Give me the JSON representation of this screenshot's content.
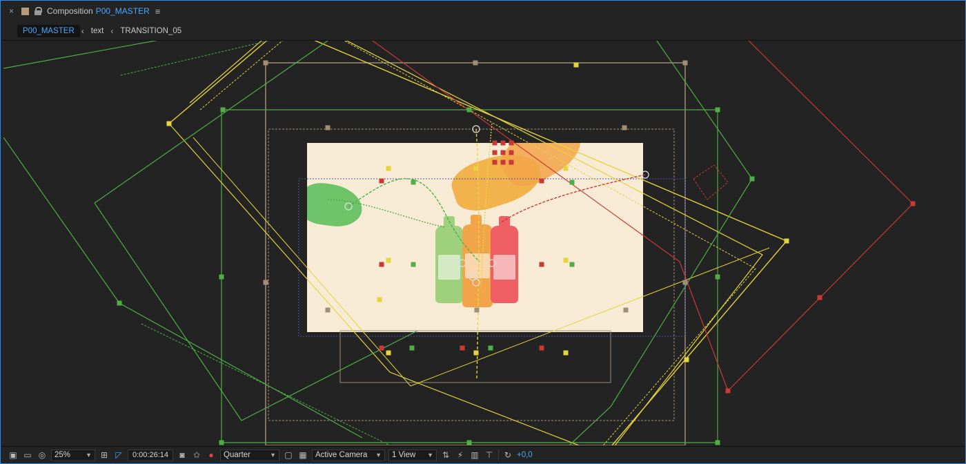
{
  "panel": {
    "title_label": "Composition",
    "comp_name": "P00_MASTER"
  },
  "breadcrumbs": [
    {
      "label": "P00_MASTER",
      "active": true
    },
    {
      "label": "text",
      "active": false
    },
    {
      "label": "TRANSITION_05",
      "active": false
    }
  ],
  "viewer": {
    "colors": {
      "yellow": "#e6d43c",
      "green": "#4fae45",
      "red": "#c93a36",
      "tan": "#a08e76",
      "blue": "#4a4fb8",
      "frame_bg": "#f7ebd6",
      "bottle_green": "#9fd07c",
      "bottle_orange": "#f2a548",
      "bottle_red": "#ee5e63",
      "hand_green": "#6fc46a",
      "hand_orange": "#f3b34c"
    }
  },
  "bottom_bar": {
    "zoom": "25%",
    "timecode": "0:00:26:14",
    "resolution": "Quarter",
    "camera": "Active Camera",
    "views": "1 View",
    "exposure": "+0,0",
    "icons": [
      "always-preview-icon",
      "monitor-icon",
      "mask-visibility-icon",
      "region-of-interest-icon",
      "transparency-grid-icon",
      "snapshot-icon",
      "show-snapshot-icon",
      "color-channel-icon",
      "fast-preview-icon",
      "toggle-transparency-icon",
      "reset-exposure-icon",
      "timeline-icon",
      "flowchart-icon",
      "comp-flowchart-icon"
    ]
  }
}
